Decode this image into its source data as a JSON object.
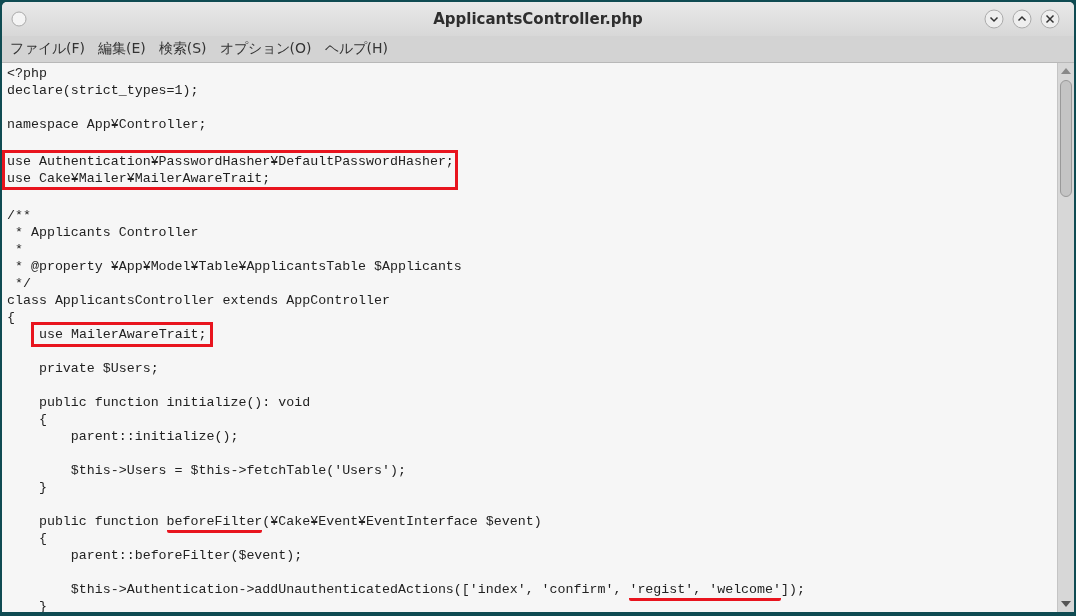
{
  "window": {
    "title": "ApplicantsController.php"
  },
  "menu": [
    "ファイル(F)",
    "編集(E)",
    "検索(S)",
    "オプション(O)",
    "ヘルプ(H)"
  ],
  "code": [
    {
      "kind": "line",
      "segments": [
        {
          "text": "<?php"
        }
      ]
    },
    {
      "kind": "line",
      "segments": [
        {
          "text": "declare(strict_types=1);"
        }
      ]
    },
    {
      "kind": "blank"
    },
    {
      "kind": "line",
      "segments": [
        {
          "text": "namespace App¥Controller;"
        }
      ]
    },
    {
      "kind": "blank"
    },
    {
      "kind": "boxed_block",
      "lines": [
        "use Authentication¥PasswordHasher¥DefaultPasswordHasher;",
        "use Cake¥Mailer¥MailerAwareTrait;"
      ]
    },
    {
      "kind": "blank"
    },
    {
      "kind": "line",
      "segments": [
        {
          "text": "/**"
        }
      ]
    },
    {
      "kind": "line",
      "segments": [
        {
          "text": " * Applicants Controller"
        }
      ]
    },
    {
      "kind": "line",
      "segments": [
        {
          "text": " *"
        }
      ]
    },
    {
      "kind": "line",
      "segments": [
        {
          "text": " * @property ¥App¥Model¥Table¥ApplicantsTable $Applicants"
        }
      ]
    },
    {
      "kind": "line",
      "segments": [
        {
          "text": " */"
        }
      ]
    },
    {
      "kind": "line",
      "segments": [
        {
          "text": "class ApplicantsController extends AppController"
        }
      ]
    },
    {
      "kind": "line",
      "segments": [
        {
          "text": "{"
        }
      ]
    },
    {
      "kind": "boxed_member",
      "text": "use MailerAwareTrait;"
    },
    {
      "kind": "blank"
    },
    {
      "kind": "line",
      "segments": [
        {
          "text": "    private $Users;"
        }
      ]
    },
    {
      "kind": "blank"
    },
    {
      "kind": "line",
      "segments": [
        {
          "text": "    public function initialize(): void"
        }
      ]
    },
    {
      "kind": "line",
      "segments": [
        {
          "text": "    {"
        }
      ]
    },
    {
      "kind": "line",
      "segments": [
        {
          "text": "        parent::initialize();"
        }
      ]
    },
    {
      "kind": "blank"
    },
    {
      "kind": "line",
      "segments": [
        {
          "text": "        $this->Users = $this->fetchTable('Users');"
        }
      ]
    },
    {
      "kind": "line",
      "segments": [
        {
          "text": "    }"
        }
      ]
    },
    {
      "kind": "blank"
    },
    {
      "kind": "line",
      "segments": [
        {
          "text": "    public function "
        },
        {
          "text": "beforeFilter",
          "underlined": true
        },
        {
          "text": "(¥Cake¥Event¥EventInterface $event)"
        }
      ]
    },
    {
      "kind": "line",
      "segments": [
        {
          "text": "    {"
        }
      ]
    },
    {
      "kind": "line",
      "segments": [
        {
          "text": "        parent::beforeFilter($event);"
        }
      ]
    },
    {
      "kind": "blank"
    },
    {
      "kind": "line",
      "segments": [
        {
          "text": "        $this->Authentication->addUnauthenticatedActions(['index', 'confirm', "
        },
        {
          "text": "'regist', 'welcome'",
          "underlined": true
        },
        {
          "text": "]);"
        }
      ]
    },
    {
      "kind": "line",
      "segments": [
        {
          "text": "    }"
        }
      ]
    }
  ]
}
